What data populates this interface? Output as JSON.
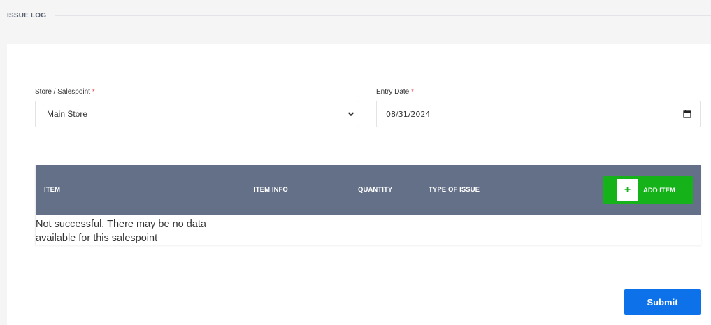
{
  "header": {
    "title": "ISSUE LOG"
  },
  "form": {
    "store_label": "Store / Salespoint",
    "store_required": "*",
    "store_value": "Main Store",
    "date_label": "Entry Date",
    "date_required": "*",
    "date_value": "08/31/2024"
  },
  "table": {
    "columns": [
      "ITEM",
      "ITEM INFO",
      "QUANTITY",
      "TYPE OF ISSUE"
    ],
    "add_item_icon": "+",
    "add_item_label": "ADD ITEM",
    "empty_message": "Not successful. There may be no data available for this salespoint"
  },
  "actions": {
    "submit_label": "Submit"
  },
  "colors": {
    "table_header": "#637087",
    "add_button": "#15b21a",
    "submit_button": "#0d72ea",
    "required_mark": "#e53935"
  },
  "icons": {
    "select_arrow": "chevron-down-icon",
    "date_picker": "calendar-icon"
  }
}
